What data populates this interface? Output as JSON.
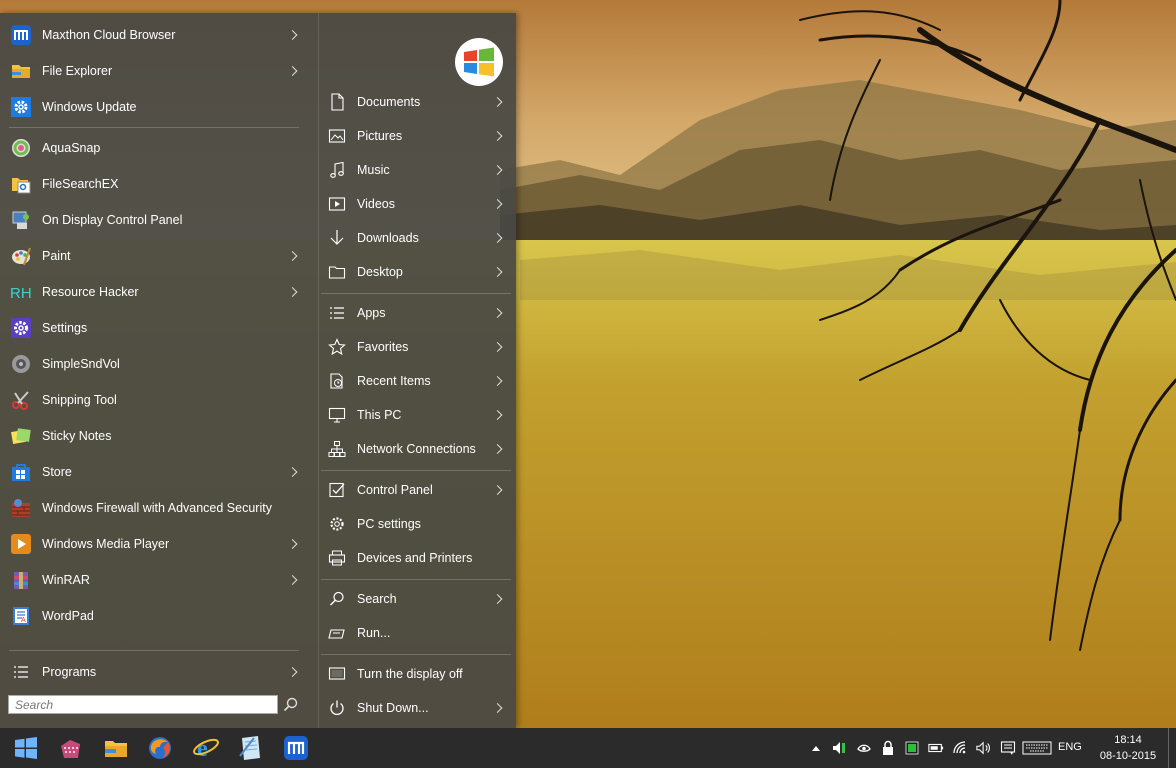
{
  "start_menu": {
    "programs": [
      {
        "label": "Maxthon Cloud Browser",
        "icon": "maxthon-icon",
        "arrow": true
      },
      {
        "label": "File Explorer",
        "icon": "folder-icon",
        "arrow": true
      },
      {
        "label": "Windows Update",
        "icon": "gear-icon",
        "arrow": false
      },
      {
        "label": "AquaSnap",
        "icon": "aquasnap-icon",
        "arrow": false
      },
      {
        "label": "FileSearchEX",
        "icon": "filesearch-icon",
        "arrow": false
      },
      {
        "label": "On Display Control Panel",
        "icon": "display-panel-icon",
        "arrow": false
      },
      {
        "label": "Paint",
        "icon": "paint-palette-icon",
        "arrow": true
      },
      {
        "label": "Resource Hacker",
        "icon": "rh-icon",
        "arrow": true
      },
      {
        "label": "Settings",
        "icon": "settings-gear-icon",
        "arrow": false
      },
      {
        "label": "SimpleSndVol",
        "icon": "speaker-icon",
        "arrow": false
      },
      {
        "label": "Snipping Tool",
        "icon": "scissors-icon",
        "arrow": false
      },
      {
        "label": "Sticky Notes",
        "icon": "sticky-notes-icon",
        "arrow": false
      },
      {
        "label": "Store",
        "icon": "store-icon",
        "arrow": true
      },
      {
        "label": "Windows Firewall with Advanced Security",
        "icon": "firewall-icon",
        "arrow": false
      },
      {
        "label": "Windows Media Player",
        "icon": "media-player-icon",
        "arrow": true
      },
      {
        "label": "WinRAR",
        "icon": "winrar-icon",
        "arrow": true
      },
      {
        "label": "WordPad",
        "icon": "wordpad-icon",
        "arrow": false
      }
    ],
    "all_programs_label": "Programs",
    "search_placeholder": "Search",
    "places": [
      {
        "label": "Documents",
        "icon": "document-icon",
        "arrow": true
      },
      {
        "label": "Pictures",
        "icon": "picture-icon",
        "arrow": true
      },
      {
        "label": "Music",
        "icon": "music-note-icon",
        "arrow": true
      },
      {
        "label": "Videos",
        "icon": "video-icon",
        "arrow": true
      },
      {
        "label": "Downloads",
        "icon": "download-arrow-icon",
        "arrow": true
      },
      {
        "label": "Desktop",
        "icon": "desktop-folder-icon",
        "arrow": true
      },
      {
        "label": "Apps",
        "icon": "list-icon",
        "arrow": true
      },
      {
        "label": "Favorites",
        "icon": "star-icon",
        "arrow": true
      },
      {
        "label": "Recent Items",
        "icon": "recent-icon",
        "arrow": true
      },
      {
        "label": "This PC",
        "icon": "pc-icon",
        "arrow": true
      },
      {
        "label": "Network Connections",
        "icon": "network-icon",
        "arrow": true
      },
      {
        "label": "Control Panel",
        "icon": "checkbox-icon",
        "arrow": true
      },
      {
        "label": "PC settings",
        "icon": "cog-icon",
        "arrow": false
      },
      {
        "label": "Devices and Printers",
        "icon": "printer-icon",
        "arrow": false
      },
      {
        "label": "Search",
        "icon": "magnifier-icon",
        "arrow": true
      },
      {
        "label": "Run...",
        "icon": "run-icon",
        "arrow": false
      },
      {
        "label": "Turn the display off",
        "icon": "display-off-icon",
        "arrow": false
      },
      {
        "label": "Shut Down...",
        "icon": "power-icon",
        "arrow": true
      }
    ]
  },
  "taskbar": {
    "pinned": [
      {
        "name": "start-button",
        "icon": "windows-logo-icon"
      },
      {
        "name": "taskbar-winrar",
        "icon": "winrar-icon"
      },
      {
        "name": "taskbar-file-explorer",
        "icon": "folder-icon"
      },
      {
        "name": "taskbar-firefox",
        "icon": "browser-globe-icon"
      },
      {
        "name": "taskbar-internet-explorer",
        "icon": "internet-explorer-icon"
      },
      {
        "name": "taskbar-notepad",
        "icon": "notepad-icon"
      },
      {
        "name": "taskbar-maxthon",
        "icon": "maxthon-icon"
      }
    ],
    "language": "ENG",
    "time": "18:14",
    "date": "08-10-2015"
  },
  "colors": {
    "menu_bg": "#4a4a46",
    "taskbar_bg": "#2b2b2b",
    "accent_blue": "#1e7be0",
    "maxthon_blue": "#1a63d0"
  }
}
